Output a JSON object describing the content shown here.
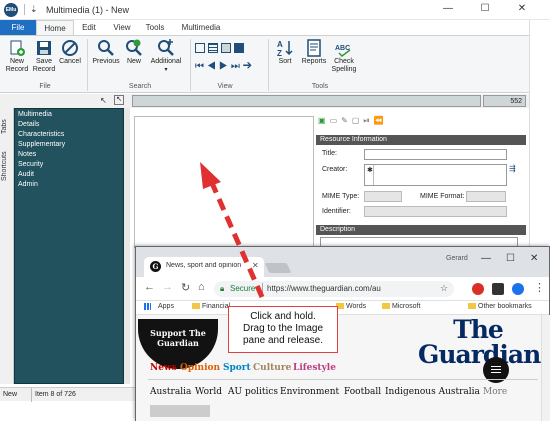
{
  "window": {
    "title": "Multimedia (1) - New",
    "logo_text": "EMu",
    "minimize": "—",
    "maximize": "☐",
    "close": "✕"
  },
  "ribbon": {
    "tabs": [
      "File",
      "Home",
      "Edit",
      "View",
      "Tools",
      "Multimedia"
    ],
    "buttons": {
      "new_record": "New\nRecord",
      "save_record": "Save\nRecord",
      "cancel": "Cancel",
      "previous": "Previous",
      "new": "New",
      "additional": "Additional",
      "sort": "Sort",
      "reports": "Reports",
      "check_spelling": "Check\nSpelling"
    },
    "groups": [
      "File",
      "Search",
      "View",
      "Tools"
    ]
  },
  "side_tabs": [
    "Tabs",
    "Shortcuts"
  ],
  "nav_items": [
    "Multimedia",
    "Details",
    "Characteristics",
    "Supplementary",
    "Notes",
    "Security",
    "Audit",
    "Admin"
  ],
  "record_count": "552",
  "resource_panel": {
    "header": "Resource Information",
    "title_label": "Title:",
    "creator_label": "Creator:",
    "mime_type_label": "MIME Type:",
    "mime_format_label": "MIME Format:",
    "identifier_label": "Identifier:",
    "description_header": "Description"
  },
  "status": {
    "mode": "New",
    "item": "Item 8 of 726"
  },
  "browser": {
    "tab_title": "News, sport and opinion",
    "user": "Gerard",
    "secure_label": "Secure",
    "url": "https://www.theguardian.com/au",
    "bookmarks": [
      "Apps",
      "Financial",
      "Words",
      "Microsoft",
      "Other bookmarks"
    ],
    "page": {
      "support_badge": "Support The Guardian",
      "logo_line1": "The",
      "logo_line2": "Guardian",
      "nav": [
        {
          "label": "News",
          "color": "#c70000"
        },
        {
          "label": "Opinion",
          "color": "#e05e00"
        },
        {
          "label": "Sport",
          "color": "#0084c6"
        },
        {
          "label": "Culture",
          "color": "#a1845c"
        },
        {
          "label": "Lifestyle",
          "color": "#bb3b80"
        }
      ],
      "subnav": [
        "Australia",
        "World",
        "AU politics",
        "Environment",
        "Football",
        "Indigenous Australia",
        "More"
      ]
    }
  },
  "callout": {
    "line1": "Click and hold.",
    "line2": "Drag to the Image",
    "line3": "pane and release."
  },
  "colors": {
    "accent": "#1e6fc1",
    "nav_bg": "#21525e",
    "arrow": "#e03030",
    "guardian_blue": "#052962"
  }
}
